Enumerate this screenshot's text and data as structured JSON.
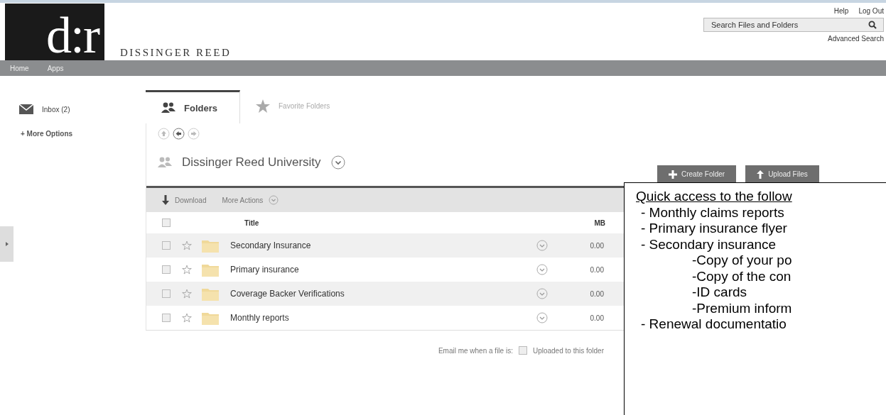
{
  "header": {
    "logo": "d:r",
    "brand": "DISSINGER REED",
    "links": [
      "Help",
      "Log Out"
    ],
    "search": {
      "placeholder": "Search Files and Folders"
    },
    "advanced_search": "Advanced Search"
  },
  "nav": [
    "Home",
    "Apps"
  ],
  "sidebar": {
    "inbox": "Inbox (2)",
    "more_options": "+ More Options"
  },
  "tabs": [
    {
      "label": "Folders",
      "selected": true
    },
    {
      "label": "Favorite Folders",
      "selected": false
    }
  ],
  "folder_title": "Dissinger Reed University",
  "buttons": [
    {
      "label": "Create Folder",
      "kind": "create"
    },
    {
      "label": "Upload Files",
      "kind": "upload"
    }
  ],
  "actions": [
    {
      "label": "Download",
      "kind": "download"
    },
    {
      "label": "More Actions",
      "kind": "menu"
    }
  ],
  "table": {
    "columns": [
      "Title",
      "MB"
    ],
    "select_all_checked": false,
    "rows": [
      {
        "title": "Secondary Insurance",
        "size": "0.00",
        "checked": false
      },
      {
        "title": "Primary insurance",
        "size": "0.00",
        "checked": false
      },
      {
        "title": "Coverage Backer Verifications",
        "size": "0.00",
        "checked": false
      },
      {
        "title": "Monthly reports",
        "size": "0.00",
        "checked": false
      }
    ]
  },
  "email": {
    "label": "Email me when a file is:",
    "option": "Uploaded to this folder",
    "checked": false
  },
  "callout": {
    "heading": "Quick access to the follow",
    "items": [
      {
        "text": "- Monthly claims reports"
      },
      {
        "text": "- Primary insurance flyer"
      },
      {
        "text": "- Secondary insurance",
        "children": [
          {
            "text": "-Copy of your po"
          },
          {
            "text": "-Copy of the con"
          },
          {
            "text": "-ID cards"
          },
          {
            "text": "-Premium inform"
          }
        ]
      },
      {
        "text": "- Renewal documentatio"
      }
    ]
  }
}
